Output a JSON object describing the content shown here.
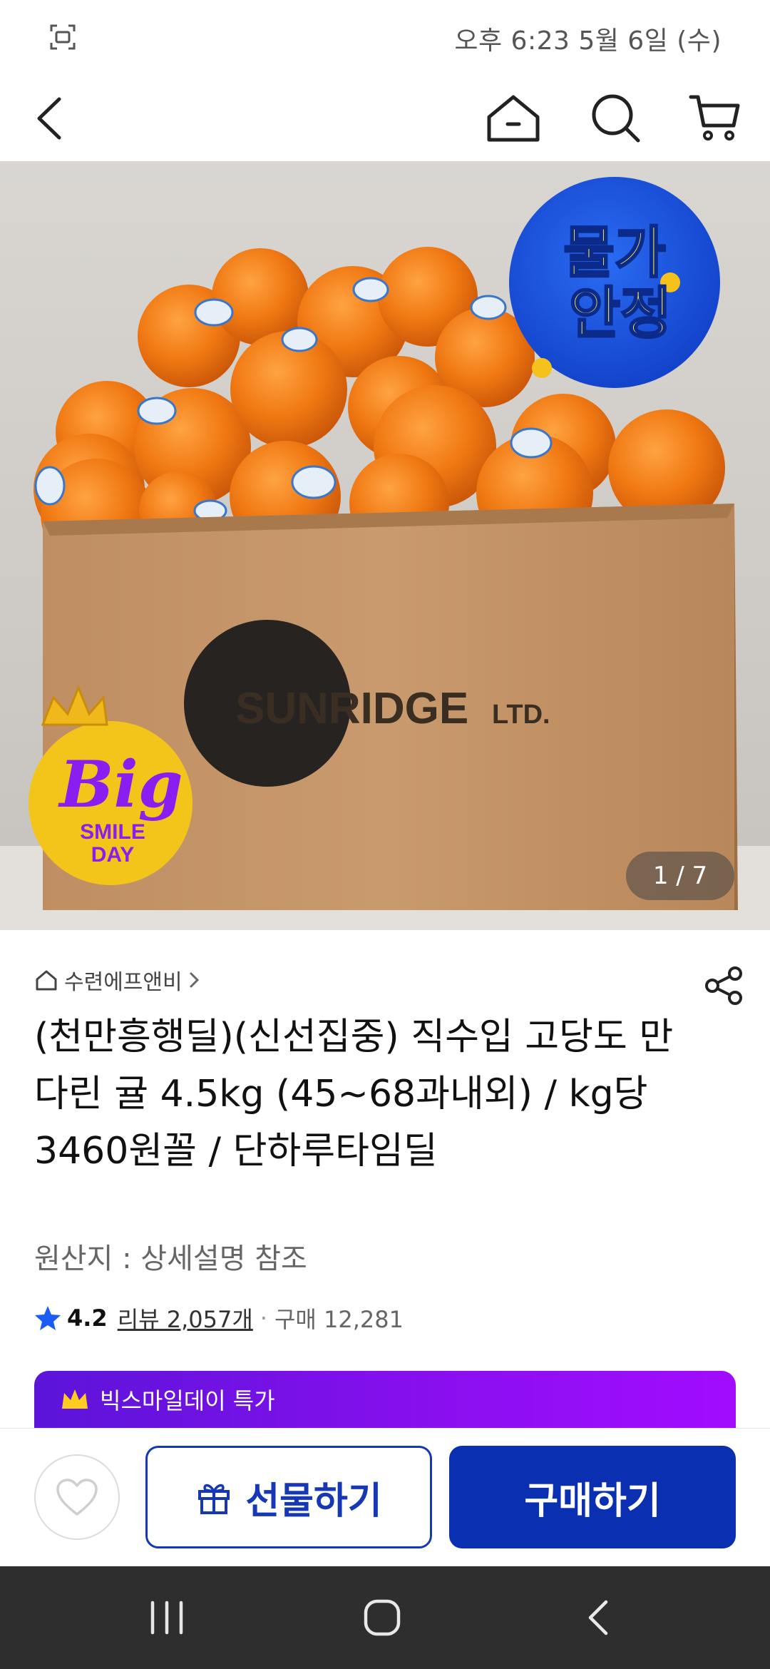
{
  "status_bar": {
    "time": "오후 6:23  5월 6일 (수)"
  },
  "hero": {
    "badge_top_line1": "물가",
    "badge_top_line2": "안정",
    "badge_bottom_big": "Big",
    "badge_bottom_line1": "SMILE",
    "badge_bottom_line2": "DAY",
    "box_brand": "SUNRIDGE",
    "box_brand_suffix": "LTD.",
    "counter": "1 / 7"
  },
  "product": {
    "seller": "수련에프앤비",
    "title": "(천만흥행딜)(신선집중) 직수입 고당도 만다린 귤 4.5kg (45~68과내외) / kg당 3460원꼴 / 단하루타임딜",
    "origin": "원산지 : 상세설명 참조",
    "rating": "4.2",
    "reviews": "리뷰 2,057개",
    "separator": "·",
    "purchases": "구매 12,281",
    "promo": "빅스마일데이 특가"
  },
  "actions": {
    "gift": "선물하기",
    "buy": "구매하기"
  },
  "colors": {
    "brand_blue": "#0a2fb0",
    "promo_purple": "#8b0ff0",
    "star_blue": "#1a5cf5"
  }
}
